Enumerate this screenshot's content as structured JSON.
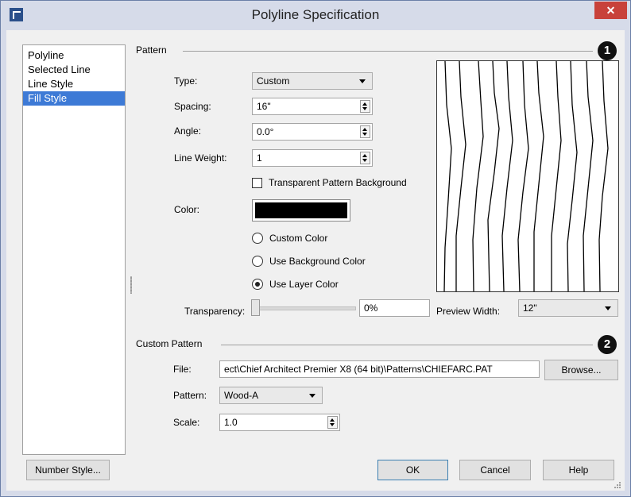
{
  "window": {
    "title": "Polyline Specification",
    "close_glyph": "✕"
  },
  "sidebar": {
    "items": [
      {
        "label": "Polyline",
        "selected": false
      },
      {
        "label": "Selected Line",
        "selected": false
      },
      {
        "label": "Line Style",
        "selected": false
      },
      {
        "label": "Fill Style",
        "selected": true
      }
    ]
  },
  "pattern": {
    "group_label": "Pattern",
    "badge": "1",
    "type_label": "Type:",
    "type_value": "Custom",
    "spacing_label": "Spacing:",
    "spacing_value": "16\"",
    "angle_label": "Angle:",
    "angle_value": "0.0°",
    "line_weight_label": "Line Weight:",
    "line_weight_value": "1",
    "transparent_bg_label": "Transparent Pattern Background",
    "transparent_bg_checked": false,
    "color_label": "Color:",
    "color_value": "#000000",
    "color_options": [
      {
        "label": "Custom Color",
        "selected": false
      },
      {
        "label": "Use Background Color",
        "selected": false
      },
      {
        "label": "Use Layer Color",
        "selected": true
      }
    ],
    "transparency_label": "Transparency:",
    "transparency_value": "0%",
    "preview_width_label": "Preview Width:",
    "preview_width_value": "12\""
  },
  "custom_pattern": {
    "group_label": "Custom Pattern",
    "badge": "2",
    "file_label": "File:",
    "file_value": "ect\\Chief Architect Premier X8 (64 bit)\\Patterns\\CHIEFARC.PAT",
    "browse_label": "Browse...",
    "pattern_label": "Pattern:",
    "pattern_value": "Wood-A",
    "scale_label": "Scale:",
    "scale_value": "1.0"
  },
  "footer": {
    "number_style_label": "Number Style...",
    "ok_label": "OK",
    "cancel_label": "Cancel",
    "help_label": "Help"
  },
  "icons": [
    "app-icon",
    "close-icon",
    "dropdown-arrow-icon",
    "spinner-icon",
    "resize-grip-icon"
  ]
}
